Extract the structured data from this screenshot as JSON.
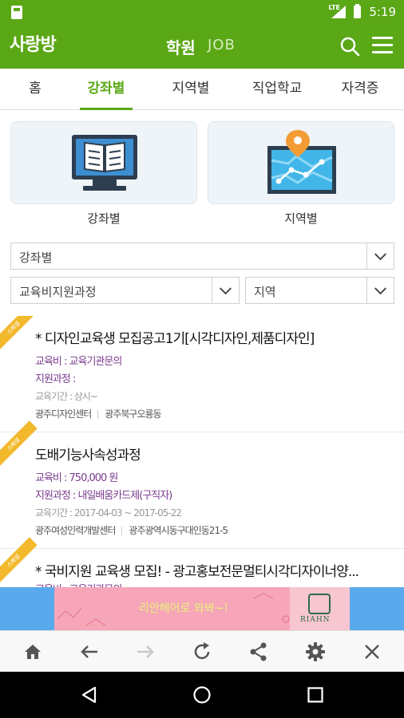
{
  "status": {
    "time": "5:19",
    "network": "LTE"
  },
  "appbar": {
    "logo": "사랑방",
    "title": "학원",
    "subtitle": "JOB"
  },
  "tabs": [
    "홈",
    "강좌별",
    "지역별",
    "직업학교",
    "자격증"
  ],
  "active_tab": 1,
  "cards": [
    {
      "label": "강좌별",
      "icon": "monitor-book-icon"
    },
    {
      "label": "지역별",
      "icon": "map-pin-icon"
    }
  ],
  "filters": {
    "category": "강좌별",
    "course": "교육비지원과정",
    "region": "지역"
  },
  "listings": [
    {
      "badge": "스폐셜",
      "title": "* 디자인교육생 모집공고1기[시각디자인,제품디자인]",
      "fee": "교육비 : 교육기관문의",
      "support": "지원과정 :",
      "period": "교육기간 : 상시~",
      "institution": "광주디자인센터",
      "location": "광주북구오룡동"
    },
    {
      "badge": "스폐셜",
      "title": "도배기능사속성과정",
      "fee": "교육비 : 750,000 원",
      "support": "지원과정 : 내일배움카드제(구직자)",
      "period": "교육기간 : 2017-04-03 ~ 2017-05-22",
      "institution": "광주여성인력개발센터",
      "location": "광주광역시동구대인동21-5"
    },
    {
      "badge": "스폐셜",
      "title": "* 국비지원 교육생 모집! - 광고홍보전문멀티시각디자이너양...",
      "fee": "교육비 : 교육기관문의",
      "support": "",
      "period": "",
      "institution": "",
      "location": ""
    }
  ],
  "ad": {
    "text": "리안헤어로 와봐~!",
    "brand": "RIAHN"
  },
  "colors": {
    "primary": "#5ba817",
    "badge": "#f2b92d",
    "purple": "#7b3c8e",
    "ad_bg": "#5ba9ed",
    "ad_inner": "#f6a6b8"
  }
}
